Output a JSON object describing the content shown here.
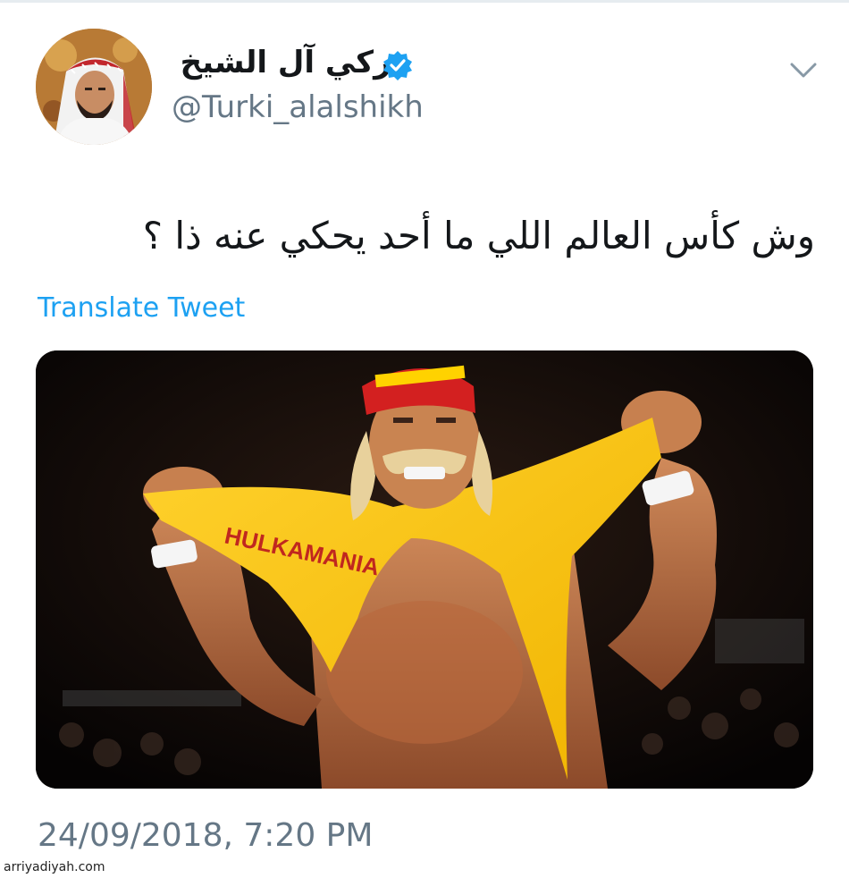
{
  "tweet": {
    "author": {
      "display_name": "تركي آل الشيخ",
      "handle": "@Turki_alalshikh",
      "verified": true
    },
    "text": "وش كأس العالم اللي ما أحد يحكي عنه ذا ؟",
    "translate_label": "Translate Tweet",
    "timestamp": "24/09/2018, 7:20 PM",
    "menu_icon": "chevron-down-icon"
  },
  "media": {
    "description_icon": "photo",
    "shirt_print": "HULKAMANIA"
  },
  "watermark": "arriyadiyah.com",
  "colors": {
    "link": "#1da1f2",
    "muted": "#657786",
    "verified": "#1da1f2"
  }
}
